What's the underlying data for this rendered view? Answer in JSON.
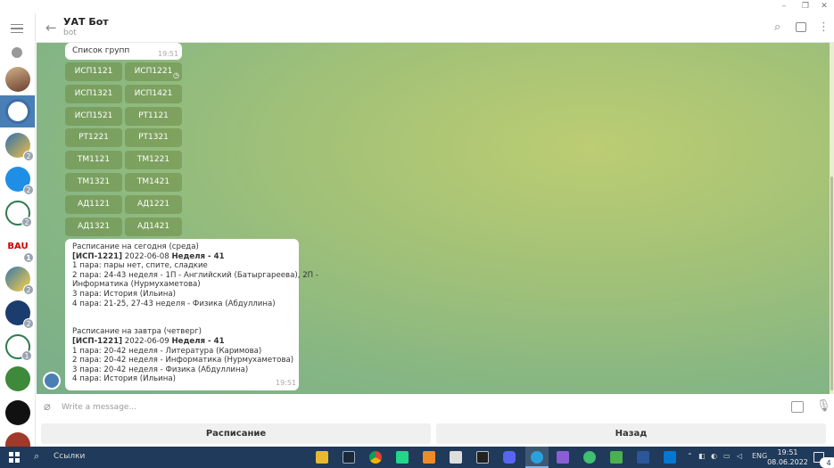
{
  "window": {
    "minimize": "–",
    "restore": "❐",
    "close": "✕"
  },
  "header": {
    "back_icon": "arrow-left-icon",
    "title": "УАТ Бот",
    "subtitle": "bot",
    "search_icon": "search-icon",
    "sidebar_icon": "sidebar-icon",
    "menu_icon": "more-vertical-icon"
  },
  "rail": {
    "badges": [
      "",
      "2",
      "2",
      "2",
      "1",
      "2",
      "2",
      "1"
    ]
  },
  "chat": {
    "group_list_message": {
      "text": "Список групп",
      "time": "19:51"
    },
    "inline_keyboard": [
      [
        "ИСП1121",
        "ИСП1221"
      ],
      [
        "ИСП1321",
        "ИСП1421"
      ],
      [
        "ИСП1521",
        "РТ1121"
      ],
      [
        "РТ1221",
        "РТ1321"
      ],
      [
        "ТМ1121",
        "ТМ1221"
      ],
      [
        "ТМ1321",
        "ТМ1421"
      ],
      [
        "АД1121",
        "АД1221"
      ],
      [
        "АД1321",
        "АД1421"
      ]
    ],
    "schedule_message": {
      "today_header": "Расписание на сегодня (среда)",
      "today_group": "[ИСП-1221]",
      "today_date": " 2022-06-08 ",
      "today_week": "Неделя - 41",
      "today_lines": [
        "1 пара: пары нет, спите, сладкие",
        "2 пара: 24-43 неделя - 1П - Английский (Батыргареева), 2П -",
        "Информатика (Нурмухаметова)",
        "3 пара: История (Ильина)",
        "4 пара: 21-25, 27-43 неделя - Физика (Абдуллина)"
      ],
      "tomorrow_header": "Расписание на завтра (четверг)",
      "tomorrow_group": "[ИСП-1221]",
      "tomorrow_date": " 2022-06-09 ",
      "tomorrow_week": "Неделя - 41",
      "tomorrow_lines": [
        "1 пара: 20-42 неделя - Литература (Каримова)",
        "2 пара: 20-42 неделя - Информатика (Нурмухаметова)",
        "3 пара: 20-42 неделя - Физика (Абдуллина)",
        "4 пара: История (Ильина)"
      ],
      "time": "19:51"
    }
  },
  "composer": {
    "placeholder": "Write a message...",
    "attach_icon": "paperclip-icon",
    "keyboard_icon": "keyboard-toggle-icon",
    "mic_icon": "microphone-icon"
  },
  "reply_keyboard": {
    "left": "Расписание",
    "right": "Назад"
  },
  "taskbar": {
    "search_label": "Ссылки",
    "lang": "ENG",
    "time": "19:51",
    "date": "08.06.2022",
    "notifications": "4"
  }
}
